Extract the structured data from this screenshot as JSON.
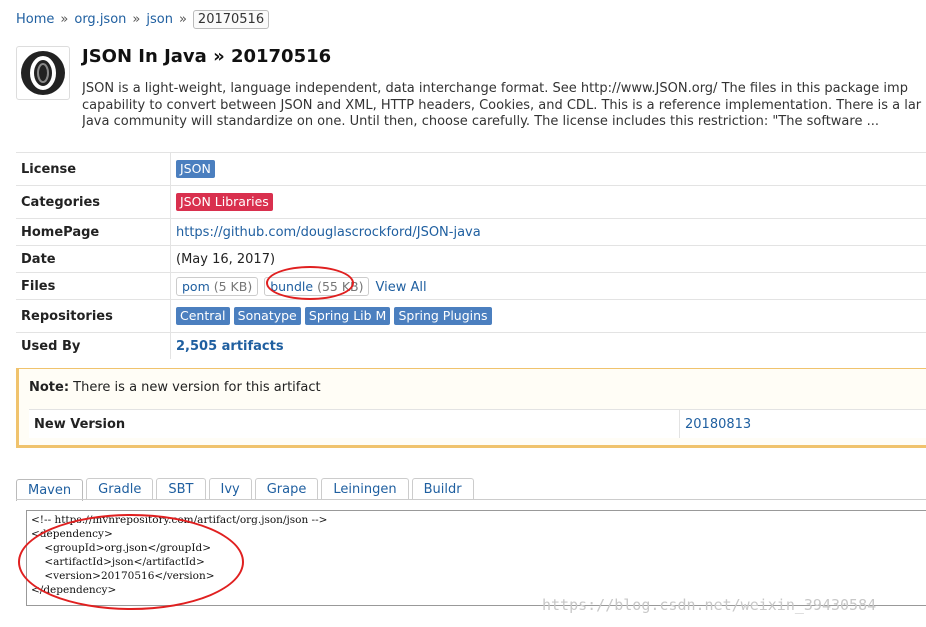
{
  "breadcrumb": {
    "items": [
      "Home",
      "org.json",
      "json"
    ],
    "separator": "»",
    "current": "20170516"
  },
  "header": {
    "logo_icon": "json-logo-icon",
    "title": "JSON In Java » 20170516",
    "description_lines": [
      "JSON is a light-weight, language independent, data interchange format. See http://www.JSON.org/ The files in this package imp",
      "capability to convert between JSON and XML, HTTP headers, Cookies, and CDL. This is a reference implementation. There is a lar",
      "Java community will standardize on one. Until then, choose carefully. The license includes this restriction: \"The software ..."
    ]
  },
  "info": {
    "license_label": "License",
    "license_value": "JSON",
    "categories_label": "Categories",
    "categories_value": "JSON Libraries",
    "homepage_label": "HomePage",
    "homepage_value": "https://github.com/douglascrockford/JSON-java",
    "date_label": "Date",
    "date_value": "(May 16, 2017)",
    "files_label": "Files",
    "files": [
      {
        "name": "pom",
        "size": "(5 KB)"
      },
      {
        "name": "bundle",
        "size": "(55 KB)"
      }
    ],
    "files_view_all": "View All",
    "repositories_label": "Repositories",
    "repositories": [
      "Central",
      "Sonatype",
      "Spring Lib M",
      "Spring Plugins"
    ],
    "used_by_label": "Used By",
    "used_by_value": "2,505 artifacts"
  },
  "note": {
    "prefix": "Note:",
    "message": " There is a new version for this artifact",
    "new_version_label": "New Version",
    "new_version_value": "20180813"
  },
  "tabs": [
    "Maven",
    "Gradle",
    "SBT",
    "Ivy",
    "Grape",
    "Leiningen",
    "Buildr"
  ],
  "active_tab": "Maven",
  "code_lines": [
    "<!-- https://mvnrepository.com/artifact/org.json/json -->",
    "<dependency>",
    "    <groupId>org.json</groupId>",
    "    <artifactId>json</artifactId>",
    "    <version>20170516</version>",
    "</dependency>"
  ],
  "watermark": "https://blog.csdn.net/weixin_39430584",
  "colors": {
    "accent_blue": "#4b7fbf",
    "category_red": "#d9304e",
    "link": "#1f5fa0",
    "note_border": "#f0c36d",
    "annotation_red": "#e02020"
  }
}
